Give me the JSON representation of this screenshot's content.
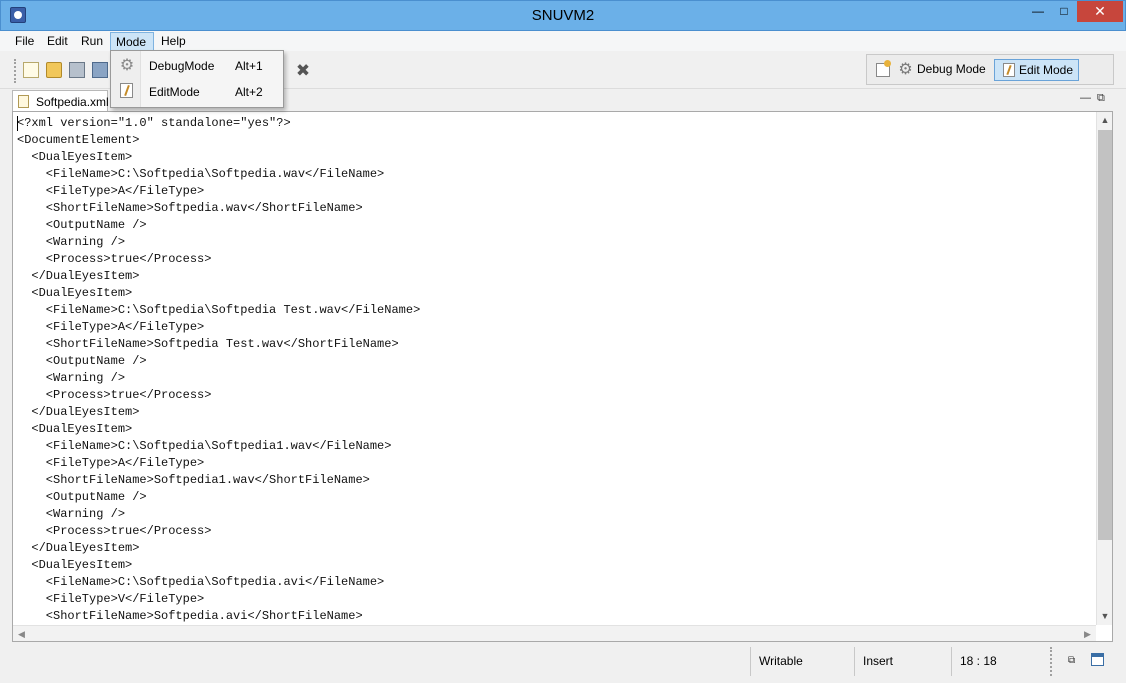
{
  "window": {
    "title": "SNUVM2",
    "min_glyph": "—",
    "max_glyph": "□",
    "close_glyph": "✕"
  },
  "menubar": {
    "items": [
      "File",
      "Edit",
      "Run",
      "Mode",
      "Help"
    ]
  },
  "mode_menu": {
    "items": [
      {
        "label": "DebugMode",
        "shortcut": "Alt+1",
        "icon": "gear-icon"
      },
      {
        "label": "EditMode",
        "shortcut": "Alt+2",
        "icon": "edit-icon"
      }
    ]
  },
  "toolbar": {
    "icons": [
      "new-file-icon",
      "open-folder-icon",
      "save-icon",
      "save-as-icon",
      "tool-icon"
    ],
    "tool_glyph": "✖"
  },
  "mode_switch": {
    "debug_label": "Debug Mode",
    "edit_label": "Edit Mode",
    "active": "Edit Mode",
    "gear_glyph": "⚙"
  },
  "editor": {
    "tab_label": "Softpedia.xml",
    "panel_min_glyph": "—",
    "panel_max_glyph": "⧉",
    "scroll_up": "▲",
    "scroll_down": "▼",
    "scroll_left": "◀",
    "scroll_right": "▶",
    "lines": [
      "<?xml version=\"1.0\" standalone=\"yes\"?>",
      "<DocumentElement>",
      "  <DualEyesItem>",
      "    <FileName>C:\\Softpedia\\Softpedia.wav</FileName>",
      "    <FileType>A</FileType>",
      "    <ShortFileName>Softpedia.wav</ShortFileName>",
      "    <OutputName />",
      "    <Warning />",
      "    <Process>true</Process>",
      "  </DualEyesItem>",
      "  <DualEyesItem>",
      "    <FileName>C:\\Softpedia\\Softpedia Test.wav</FileName>",
      "    <FileType>A</FileType>",
      "    <ShortFileName>Softpedia Test.wav</ShortFileName>",
      "    <OutputName />",
      "    <Warning />",
      "    <Process>true</Process>",
      "  </DualEyesItem>",
      "  <DualEyesItem>",
      "    <FileName>C:\\Softpedia\\Softpedia1.wav</FileName>",
      "    <FileType>A</FileType>",
      "    <ShortFileName>Softpedia1.wav</ShortFileName>",
      "    <OutputName />",
      "    <Warning />",
      "    <Process>true</Process>",
      "  </DualEyesItem>",
      "  <DualEyesItem>",
      "    <FileName>C:\\Softpedia\\Softpedia.avi</FileName>",
      "    <FileType>V</FileType>",
      "    <ShortFileName>Softpedia.avi</ShortFileName>"
    ]
  },
  "statusbar": {
    "writable": "Writable",
    "insert": "Insert",
    "position": "18 : 18",
    "icon1_glyph": "⧉"
  }
}
